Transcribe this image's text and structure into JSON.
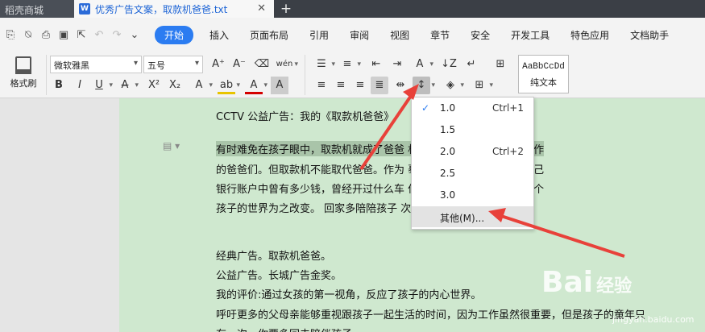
{
  "tabs": [
    {
      "label": "稻壳商城"
    },
    {
      "label": "优秀广告文案，取款机爸爸.txt"
    }
  ],
  "menu": [
    "开始",
    "插入",
    "页面布局",
    "引用",
    "审阅",
    "视图",
    "章节",
    "安全",
    "开发工具",
    "特色应用",
    "文档助手"
  ],
  "ribbon": {
    "format_painter": "格式刷",
    "font_name": "微软雅黑",
    "font_size": "五号",
    "style_preview": "AaBbCcDd",
    "style_name": "纯文本"
  },
  "document": {
    "lines": [
      "CCTV 公益广告：我的《取款机爸爸》",
      "有时难免在孩子眼中，取款机就成了爸爸                                      机的背后，都有努力辛苦工作",
      "的爸爸们。但取款机不能取代爸爸。作为                                      蓦然回首，你不会再在意自己",
      "银行账户中曾有多少钱，曾经开过什么车                                      但你会记得，因为有你，一个",
      "孩子的世界为之改变。  回家多陪陪孩子                                      次。",
      "",
      "经典广告。取款机爸爸。",
      "公益广告。长城广告金奖。",
      "我的评价:通过女孩的第一视角，反应了孩子的内心世界。",
      "呼吁更多的父母亲能够重视跟孩子一起生活的时间，因为工作虽然很重要，但是孩子的童年只",
      "有一次，你要多回去陪伴孩子。"
    ]
  },
  "line_spacing_menu": {
    "items": [
      {
        "value": "1.0",
        "shortcut": "Ctrl+1",
        "checked": true
      },
      {
        "value": "1.5",
        "shortcut": "",
        "checked": false
      },
      {
        "value": "2.0",
        "shortcut": "Ctrl+2",
        "checked": false
      },
      {
        "value": "2.5",
        "shortcut": "",
        "checked": false
      },
      {
        "value": "3.0",
        "shortcut": "",
        "checked": false
      }
    ],
    "other": "其他(M)..."
  },
  "watermark": {
    "text": "Bai",
    "suffix": "经验",
    "sub": "jingyan.baidu.com"
  },
  "colors": {
    "accent": "#2b7cf1",
    "page": "#cfe8cf",
    "arrow": "#e8413a"
  }
}
